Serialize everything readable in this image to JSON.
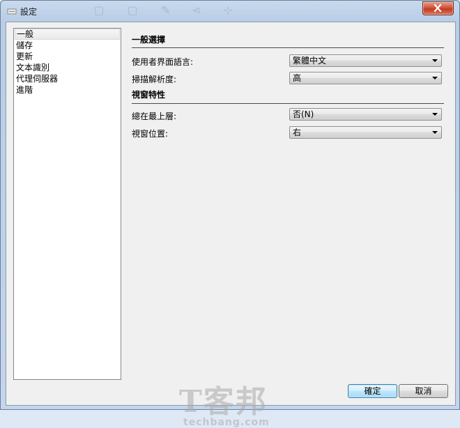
{
  "window": {
    "title": "設定"
  },
  "nav": {
    "items": [
      {
        "label": "一般",
        "selected": true
      },
      {
        "label": "儲存"
      },
      {
        "label": "更新"
      },
      {
        "label": "文本識別"
      },
      {
        "label": "代理伺服器"
      },
      {
        "label": "進階"
      }
    ]
  },
  "general": {
    "section_title": "一般選擇",
    "ui_language_label": "使用者界面語言:",
    "ui_language_value": "繁體中文",
    "scan_resolution_label": "掃描解析度:",
    "scan_resolution_value": "高"
  },
  "window_props": {
    "section_title": "視窗特性",
    "always_on_top_label": "總在最上層:",
    "always_on_top_value": "否(N)",
    "window_position_label": "視窗位置:",
    "window_position_value": "右"
  },
  "buttons": {
    "ok": "確定",
    "cancel": "取消"
  },
  "watermark": {
    "logo": "T客邦",
    "site": "techbang.com"
  }
}
